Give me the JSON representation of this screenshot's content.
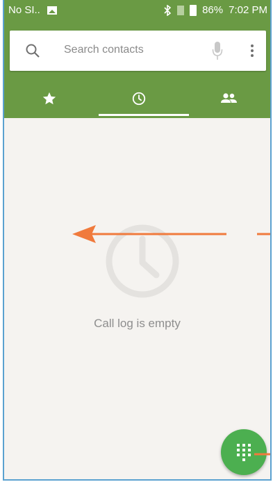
{
  "status_bar": {
    "carrier": "No SI..",
    "battery": "86%",
    "time": "7:02 PM"
  },
  "search": {
    "placeholder": "Search contacts"
  },
  "tabs": [
    {
      "icon": "star-icon"
    },
    {
      "icon": "clock-icon"
    },
    {
      "icon": "people-icon"
    }
  ],
  "call_log": {
    "empty_text": "Call log is empty"
  },
  "colors": {
    "appbar": "#6a9a44",
    "fab": "#4caf50",
    "arrow": "#f07a3c",
    "background": "#f5f3f0"
  }
}
